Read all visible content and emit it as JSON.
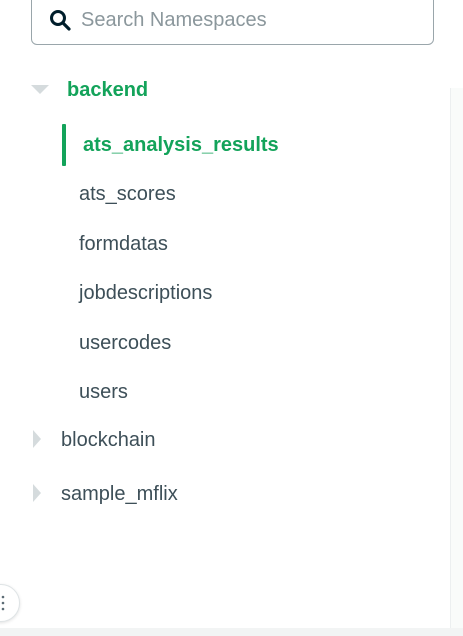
{
  "search": {
    "placeholder": "Search Namespaces",
    "value": ""
  },
  "icons": {
    "search": "search-icon",
    "expanded_caret": "caret-down-icon",
    "collapsed_caret": "caret-right-icon",
    "handle": "vertical-dots-icon"
  },
  "colors": {
    "accent": "#13a35a",
    "text": "#3d4f58",
    "caret": "#d5dbdd"
  },
  "tree": {
    "databases": [
      {
        "name": "backend",
        "expanded": true,
        "collections": [
          {
            "name": "ats_analysis_results",
            "active": true
          },
          {
            "name": "ats_scores"
          },
          {
            "name": "formdatas"
          },
          {
            "name": "jobdescriptions"
          },
          {
            "name": "usercodes"
          },
          {
            "name": "users"
          }
        ]
      },
      {
        "name": "blockchain",
        "expanded": false
      },
      {
        "name": "sample_mflix",
        "expanded": false
      }
    ]
  }
}
